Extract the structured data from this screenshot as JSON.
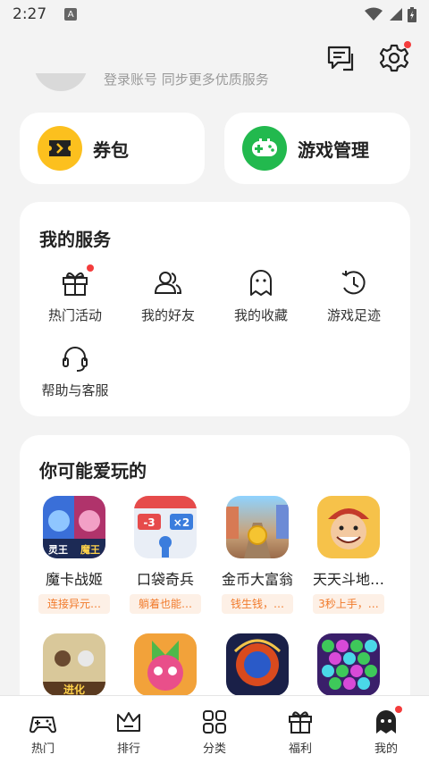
{
  "status_bar": {
    "time": "2:27",
    "a_badge": "A"
  },
  "quick_cards": {
    "coupon_label": "券包",
    "game_mgmt_label": "游戏管理"
  },
  "profile": {
    "subtitle_peek": "登录账号 同步更多优质服务"
  },
  "services": {
    "title": "我的服务",
    "items": [
      {
        "label": "热门活动",
        "icon": "gift-icon"
      },
      {
        "label": "我的好友",
        "icon": "friends-icon"
      },
      {
        "label": "我的收藏",
        "icon": "ghost-icon"
      },
      {
        "label": "游戏足迹",
        "icon": "history-icon"
      },
      {
        "label": "帮助与客服",
        "icon": "headset-icon"
      }
    ]
  },
  "recommend": {
    "title": "你可能爱玩的",
    "games": [
      {
        "name": "魔卡战姬",
        "tag": "连接异元…",
        "icon_text_left": "灵王",
        "icon_text_right": "魔王"
      },
      {
        "name": "口袋奇兵",
        "tag": "躺着也能…",
        "icon_text_left": "-3",
        "icon_text_right": "×2"
      },
      {
        "name": "金币大富翁",
        "tag": "钱生钱，…"
      },
      {
        "name": "天天斗地…",
        "tag": "3秒上手，…"
      }
    ],
    "games_row2_icon_text": "进化"
  },
  "tabbar": {
    "items": [
      {
        "label": "热门",
        "icon": "gamepad-icon"
      },
      {
        "label": "排行",
        "icon": "crown-icon"
      },
      {
        "label": "分类",
        "icon": "grid-icon"
      },
      {
        "label": "福利",
        "icon": "gift-box-icon"
      },
      {
        "label": "我的",
        "icon": "ghost-avatar-icon"
      }
    ]
  },
  "colors": {
    "accent_yellow": "#fcc01e",
    "accent_green": "#22b94e",
    "tag_orange": "#f17a2b",
    "dot_red": "#f43c3c"
  }
}
